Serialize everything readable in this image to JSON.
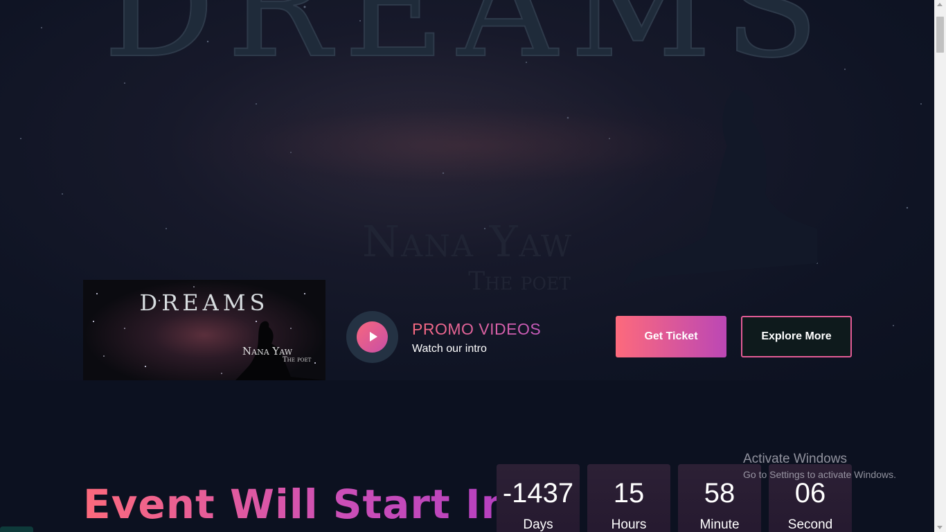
{
  "hero": {
    "title": "DREAMS",
    "artist": "Nana Yaw",
    "subtitle": "The poet"
  },
  "album": {
    "title": "DREAMS",
    "artist": "Nana Yaw",
    "subtitle": "The poet"
  },
  "promo": {
    "title": "PROMO VIDEOS",
    "subtitle": "Watch our intro",
    "icon": "play-icon"
  },
  "buttons": {
    "ticket": "Get Ticket",
    "explore": "Explore More"
  },
  "event": {
    "title": "Event Will Start In"
  },
  "countdown": [
    {
      "value": "-1437",
      "label": "Days"
    },
    {
      "value": "15",
      "label": "Hours"
    },
    {
      "value": "58",
      "label": "Minute"
    },
    {
      "value": "06",
      "label": "Second"
    }
  ],
  "watermark": {
    "title": "Activate Windows",
    "subtitle": "Go to Settings to activate Windows."
  },
  "colors": {
    "accent_start": "#fd6a7c",
    "accent_end": "#bb47b5",
    "background": "#0c1120"
  }
}
